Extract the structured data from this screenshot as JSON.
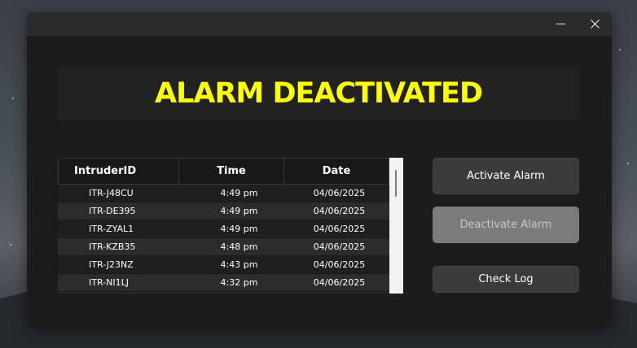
{
  "window": {
    "minimize_label": "–",
    "close_label": "✕"
  },
  "banner": {
    "status_text": "ALARM DEACTIVATED",
    "status_color": "#FFFF00"
  },
  "table": {
    "columns": [
      "IntruderID",
      "Time",
      "Date"
    ],
    "rows": [
      {
        "id": "ITR-J48CU",
        "time": "4:49 pm",
        "date": "04/06/2025"
      },
      {
        "id": "ITR-DE395",
        "time": "4:49 pm",
        "date": "04/06/2025"
      },
      {
        "id": "ITR-ZYAL1",
        "time": "4:49 pm",
        "date": "04/06/2025"
      },
      {
        "id": "ITR-KZB35",
        "time": "4:48 pm",
        "date": "04/06/2025"
      },
      {
        "id": "ITR-J23NZ",
        "time": "4:43 pm",
        "date": "04/06/2025"
      },
      {
        "id": "ITR-NI1LJ",
        "time": "4:32 pm",
        "date": "04/06/2025"
      }
    ]
  },
  "buttons": {
    "activate": "Activate Alarm",
    "deactivate": "Deactivate Alarm",
    "check_log": "Check Log"
  }
}
